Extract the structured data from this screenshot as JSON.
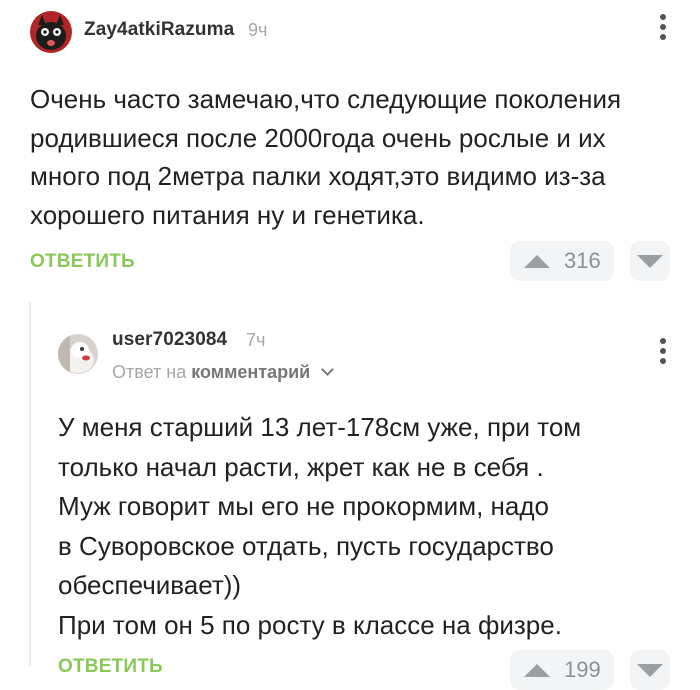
{
  "comments": [
    {
      "author": "Zay4atkiRazuma",
      "time": "9ч",
      "text_lines": [
        "Очень часто замечаю,что следующие поколения",
        "родившиеся после 2000года очень рослые и их",
        "много под 2метра палки ходят,это видимо из-за",
        "хорошего питания ну и генетика."
      ],
      "reply_label": "ОТВЕТИТЬ",
      "rating": "316"
    },
    {
      "author": "user7023084",
      "time": "7ч",
      "reply_to_prefix": "Ответ на",
      "reply_to_target": "комментарий",
      "text_lines": [
        "У меня старший 13 лет-178см уже, при том",
        "только начал расти, жрет как не в себя .",
        "Муж говорит мы его не прокормим, надо",
        "в Суворовское отдать, пусть государство",
        "обеспечивает))",
        "При том он 5 по росту в классе на физре."
      ],
      "reply_label": "ОТВЕТИТЬ",
      "rating": "199"
    }
  ]
}
